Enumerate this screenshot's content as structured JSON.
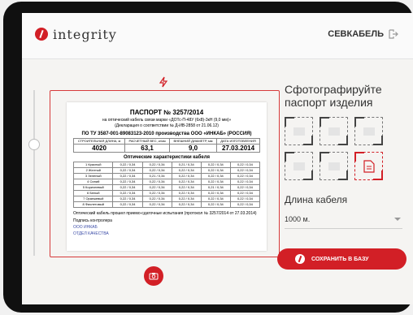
{
  "app": {
    "logo_text": "integrity",
    "user_name": "СЕВКАБЕЛЬ"
  },
  "document": {
    "title": "ПАСПОРТ № 3257/2014",
    "line1": "на оптический кабель связи марки «ДОТс-П-48У (6х8)-3кН (9,0 мм)»",
    "line2": "(Декларация о соответствии № Д-ИВ-2858 от 21.06.12)",
    "line3": "ПО ТУ 3587-001-89083123-2010 производства ООО «ИНКАБ» (РОССИЯ)",
    "table_main_headers": [
      "СТРОИТЕЛЬНАЯ ДЛИНА, м",
      "РАСЧЕТНЫЙ ВЕС, кг/км",
      "ВНЕШНИЙ ДИАМЕТР, мм",
      "ДАТА ИЗГОТОВЛЕНИЯ"
    ],
    "table_main_values": [
      "4020",
      "63,1",
      "9,0",
      "27.03.2014"
    ],
    "optics_title": "Оптические характеристики кабеля",
    "optics_rows": [
      [
        "1 Красный",
        "0,22 / 0,34",
        "0,22 / 0,34",
        "0,21 / 0,34",
        "0,22 / 0,34",
        "0,22 / 0,34"
      ],
      [
        "2 Желтый",
        "0,22 / 0,34",
        "0,22 / 0,34",
        "0,22 / 0,34",
        "0,22 / 0,34",
        "0,22 / 0,34"
      ],
      [
        "3 Зеленый",
        "0,22 / 0,34",
        "0,21 / 0,34",
        "0,22 / 0,34",
        "0,22 / 0,34",
        "0,22 / 0,34"
      ],
      [
        "4 Синий",
        "0,22 / 0,34",
        "0,22 / 0,34",
        "0,22 / 0,34",
        "0,22 / 0,34",
        "0,22 / 0,34"
      ],
      [
        "5 Коричневый",
        "0,22 / 0,34",
        "0,22 / 0,34",
        "0,22 / 0,34",
        "0,21 / 0,34",
        "0,22 / 0,34"
      ],
      [
        "6 Белый",
        "0,22 / 0,34",
        "0,22 / 0,34",
        "0,22 / 0,34",
        "0,22 / 0,34",
        "0,22 / 0,34"
      ],
      [
        "7 Оранжевый",
        "0,22 / 0,34",
        "0,22 / 0,34",
        "0,22 / 0,34",
        "0,22 / 0,34",
        "0,22 / 0,34"
      ],
      [
        "8 Фиолетовый",
        "0,22 / 0,34",
        "0,22 / 0,34",
        "0,22 / 0,34",
        "0,22 / 0,34",
        "0,22 / 0,34"
      ]
    ],
    "check_line": "Оптический кабель прошел приемо-сдаточные испытания (протокол № 3257/2014 от 27.03.2014)",
    "signature_label": "Подпись контролера",
    "stamp_line1": "ООО ИНКАБ",
    "stamp_line2": "ОТДЕЛ КАЧЕСТВА"
  },
  "side": {
    "photo_title": "Сфотографируйте паспорт изделия",
    "length_label": "Длина кабеля",
    "length_value": "1000 м.",
    "save_label": "СОХРАНИТЬ В БАЗУ"
  },
  "colors": {
    "accent": "#d21f26",
    "frame": "#d63a3a",
    "background": "#f5f4f2"
  }
}
